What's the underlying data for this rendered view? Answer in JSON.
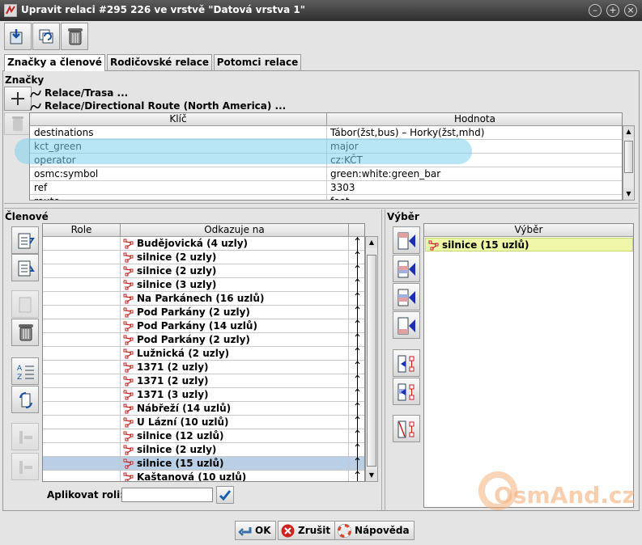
{
  "window": {
    "title": "Upravit relaci #295 226 ve vrstvě \"Datová vrstva 1\"",
    "controls": [
      "minimize",
      "maximize",
      "close"
    ]
  },
  "toolbar": {
    "buttons": [
      {
        "name": "apply-changes",
        "icon": "save-icon"
      },
      {
        "name": "reload",
        "icon": "refresh-icon"
      },
      {
        "name": "delete-relation",
        "icon": "trash-icon"
      }
    ]
  },
  "tabs": [
    {
      "label": "Značky a členové",
      "active": true
    },
    {
      "label": "Rodičovské relace",
      "active": false
    },
    {
      "label": "Potomci relace",
      "active": false
    }
  ],
  "tags": {
    "title": "Značky",
    "relation_lines": [
      "Relace/Trasa ...",
      "Relace/Directional Route (North America) ..."
    ],
    "columns": {
      "key": "Klíč",
      "value": "Hodnota"
    },
    "rows": [
      {
        "key": "destinations",
        "value": "Tábor(žst,bus) – Horky(žst,mhd)"
      },
      {
        "key": "kct_green",
        "value": "major"
      },
      {
        "key": "operator",
        "value": "cz:KČT"
      },
      {
        "key": "osmc:symbol",
        "value": "green:white:green_bar"
      },
      {
        "key": "ref",
        "value": "3303"
      },
      {
        "key": "route",
        "value": "foot"
      }
    ]
  },
  "members": {
    "title": "Členové",
    "columns": {
      "role": "Role",
      "refers": "Odkazuje na"
    },
    "rows": [
      {
        "role": "",
        "refers": "Budějovická (4 uzly)"
      },
      {
        "role": "",
        "refers": "silnice (2 uzly)"
      },
      {
        "role": "",
        "refers": "silnice (2 uzly)"
      },
      {
        "role": "",
        "refers": "silnice (3 uzly)"
      },
      {
        "role": "",
        "refers": "Na Parkánech (16 uzlů)"
      },
      {
        "role": "",
        "refers": "Pod Parkány (2 uzly)"
      },
      {
        "role": "",
        "refers": "Pod Parkány (14 uzlů)"
      },
      {
        "role": "",
        "refers": "Pod Parkány (2 uzly)"
      },
      {
        "role": "",
        "refers": "Lužnická (2 uzly)"
      },
      {
        "role": "",
        "refers": "1371 (2 uzly)"
      },
      {
        "role": "",
        "refers": "1371 (2 uzly)"
      },
      {
        "role": "",
        "refers": "1371 (3 uzly)"
      },
      {
        "role": "",
        "refers": "Nábřeží (14 uzlů)"
      },
      {
        "role": "",
        "refers": "U Lázní (10 uzlů)"
      },
      {
        "role": "",
        "refers": "silnice (12 uzlů)"
      },
      {
        "role": "",
        "refers": "silnice (2 uzly)"
      },
      {
        "role": "",
        "refers": "silnice (15 uzlů)",
        "selected": true
      },
      {
        "role": "",
        "refers": "Kaštanová (10 uzlů)"
      }
    ],
    "apply_role_label": "Aplikovat roli:",
    "apply_role_value": ""
  },
  "selection": {
    "title": "Výběr",
    "column": "Výběr",
    "items": [
      "silnice (15 uzlů)"
    ]
  },
  "buttons": {
    "ok": "OK",
    "cancel": "Zrušit",
    "help": "Nápověda"
  },
  "watermark": "OsmAnd.cz",
  "colors": {
    "titlebar": "#3a3a3a",
    "selected_row": "#b8cfe5",
    "selection_item": "#eef7a8",
    "highlight": "#7ed2ec"
  }
}
